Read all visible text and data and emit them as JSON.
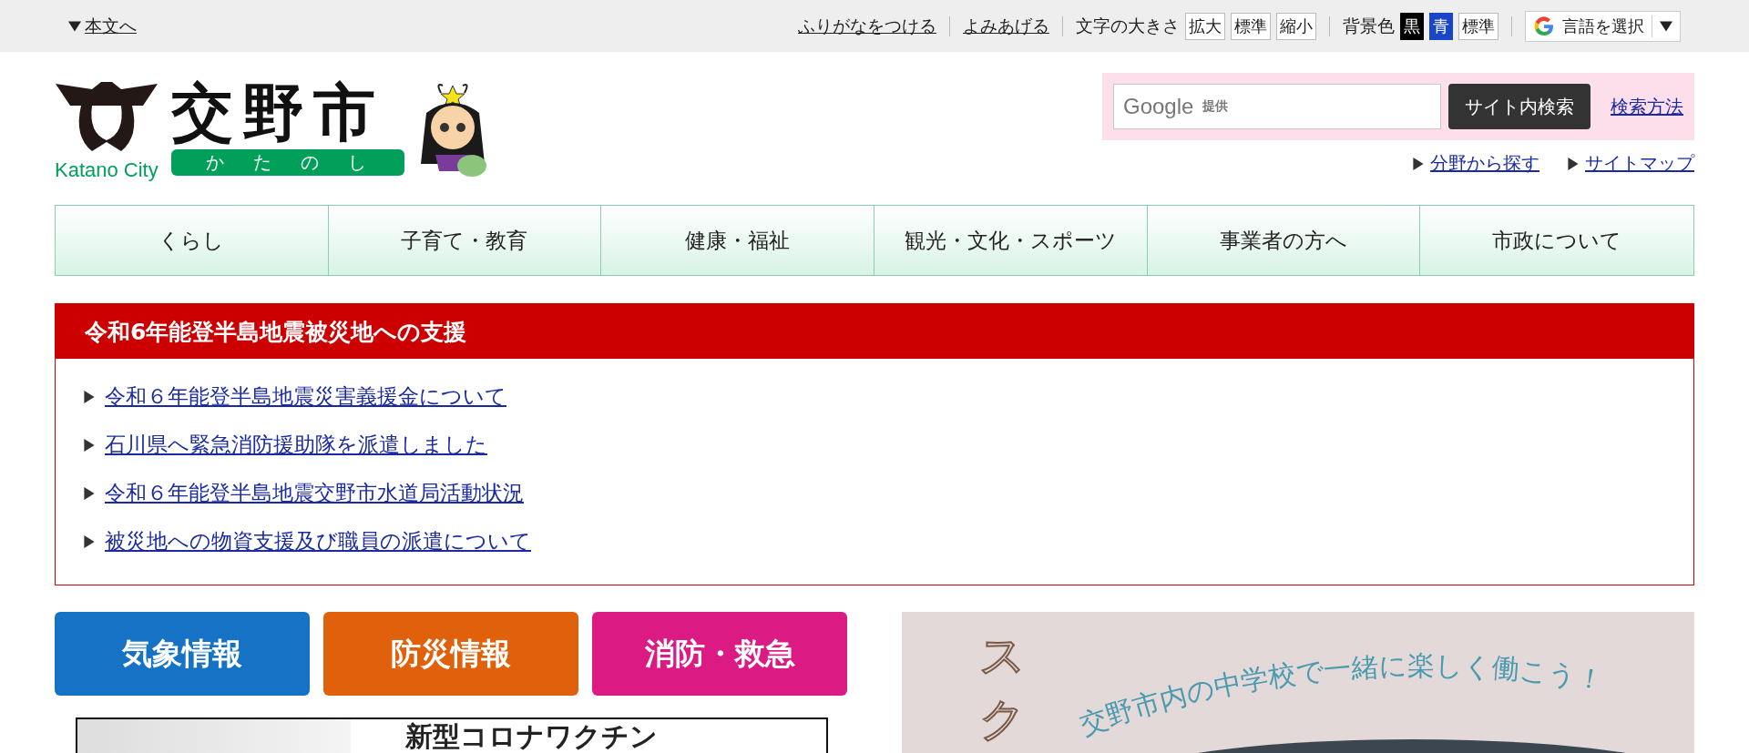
{
  "top_bar": {
    "skip_link": "本文へ",
    "links": [
      "ふりがなをつける",
      "よみあげる"
    ],
    "font_size": {
      "label": "文字の大きさ",
      "buttons": [
        "拡大",
        "標準",
        "縮小"
      ]
    },
    "background": {
      "label": "背景色",
      "buttons": [
        {
          "label": "黒",
          "kind": "black"
        },
        {
          "label": "青",
          "kind": "blue"
        },
        {
          "label": "標準",
          "kind": "standard"
        }
      ]
    },
    "translate": {
      "label": "言語を選択"
    }
  },
  "header": {
    "logo": {
      "title": "交野市",
      "english": "Katano City",
      "reading": "かたのし"
    },
    "search": {
      "brand": "Google",
      "brand_note": "提供",
      "button": "サイト内検索",
      "help_link": "検索方法"
    },
    "links": [
      "分野から探す",
      "サイトマップ"
    ]
  },
  "nav": [
    "くらし",
    "子育て・教育",
    "健康・福祉",
    "観光・文化・スポーツ",
    "事業者の方へ",
    "市政について"
  ],
  "notice": {
    "title": "令和6年能登半島地震被災地への支援",
    "items": [
      "令和６年能登半島地震災害義援金について",
      "石川県へ緊急消防援助隊を派遣しました",
      "令和６年能登半島地震交野市水道局活動状況",
      "被災地への物資支援及び職員の派遣について"
    ]
  },
  "emergency_buttons": [
    {
      "label": "気象情報",
      "color": "#1572c4"
    },
    {
      "label": "防災情報",
      "color": "#e0600c"
    },
    {
      "label": "消防・救急",
      "color": "#dc1a83"
    }
  ],
  "banners": {
    "vaccine": {
      "headline": "新型コロナワクチン"
    },
    "school": {
      "vertical_title": "スク",
      "arc_text": "交野市内の中学校で一緒に楽しく働こう！"
    }
  }
}
